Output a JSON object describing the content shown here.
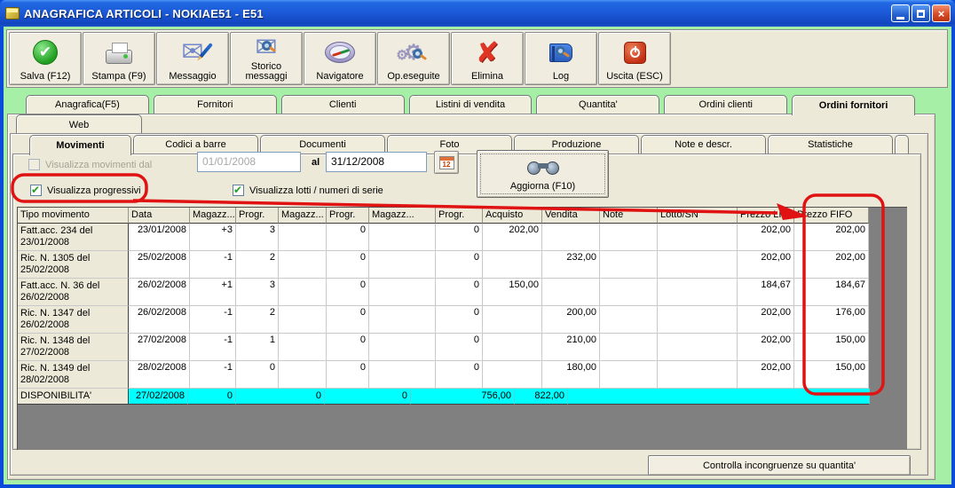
{
  "window": {
    "title": "ANAGRAFICA ARTICOLI - NOKIAE51 - E51",
    "controls": [
      "minimize",
      "maximize",
      "close"
    ]
  },
  "colors": {
    "titlebar_blue": "#1C5AD8",
    "window_green": "#A6EFA6",
    "panel_beige": "#ECE9D8",
    "grid_gray": "#808080",
    "availability_cyan": "#00FFFF",
    "annotation_red": "#E01212",
    "disabled_text": "#A5A395"
  },
  "toolbar": {
    "buttons": [
      {
        "label": "Salva (F12)",
        "icon": "save-check-icon"
      },
      {
        "label": "Stampa (F9)",
        "icon": "printer-icon"
      },
      {
        "label": "Messaggio",
        "icon": "message-envelope-icon"
      },
      {
        "label": "Storico messaggi",
        "icon": "message-history-icon"
      },
      {
        "label": "Navigatore",
        "icon": "navigator-compass-icon"
      },
      {
        "label": "Op.eseguite",
        "icon": "operations-gear-icon"
      },
      {
        "label": "Elimina",
        "icon": "delete-x-icon"
      },
      {
        "label": "Log",
        "icon": "log-book-icon"
      },
      {
        "label": "Uscita (ESC)",
        "icon": "exit-power-icon"
      }
    ]
  },
  "tabs_level1": {
    "items": [
      "Anagrafica(F5)",
      "Fornitori",
      "Clienti",
      "Listini di vendita",
      "Quantita'",
      "Ordini clienti",
      "Ordini fornitori"
    ],
    "active": "Ordini fornitori"
  },
  "tabs_level2": {
    "items": [
      "Web"
    ],
    "active": "Web"
  },
  "tabs_level3": {
    "items": [
      "Movimenti",
      "Codici a barre",
      "Documenti",
      "Foto",
      "Produzione",
      "Note e descr.",
      "Statistiche"
    ],
    "active": "Movimenti"
  },
  "filters": {
    "show_movements_label": "Visualizza movimenti dal",
    "date_from": "01/01/2008",
    "al_label": "al",
    "date_to": "31/12/2008",
    "calendar_icon_text": "12",
    "refresh_button_label": "Aggiorna (F10)",
    "show_progressives_label": "Visualizza progressivi",
    "show_lots_label": "Visualizza lotti /  numeri di serie"
  },
  "table": {
    "columns": [
      "Tipo movimento",
      "Data",
      "Magazz...",
      "Progr.",
      "Magazz...",
      "Progr.",
      "Magazz...",
      "Progr.",
      "Acquisto",
      "Vendita",
      "Note",
      "Lotto/SN",
      "Prezzo LIFO",
      "Prezzo FIFO"
    ],
    "rows": [
      [
        "Fatt.acc. 234 del 23/01/2008",
        "23/01/2008",
        "+3",
        "3",
        "",
        "0",
        "",
        "0",
        "202,00",
        "",
        "",
        "",
        "202,00",
        "202,00"
      ],
      [
        "Ric. N. 1305 del 25/02/2008",
        "25/02/2008",
        "-1",
        "2",
        "",
        "0",
        "",
        "0",
        "",
        "232,00",
        "",
        "",
        "202,00",
        "202,00"
      ],
      [
        "Fatt.acc. N. 36 del 26/02/2008",
        "26/02/2008",
        "+1",
        "3",
        "",
        "0",
        "",
        "0",
        "150,00",
        "",
        "",
        "",
        "184,67",
        "184,67"
      ],
      [
        "Ric. N. 1347 del 26/02/2008",
        "26/02/2008",
        "-1",
        "2",
        "",
        "0",
        "",
        "0",
        "",
        "200,00",
        "",
        "",
        "202,00",
        "176,00"
      ],
      [
        "Ric. N. 1348 del 27/02/2008",
        "27/02/2008",
        "-1",
        "1",
        "",
        "0",
        "",
        "0",
        "",
        "210,00",
        "",
        "",
        "202,00",
        "150,00"
      ],
      [
        "Ric. N. 1349 del 28/02/2008",
        "28/02/2008",
        "-1",
        "0",
        "",
        "0",
        "",
        "0",
        "",
        "180,00",
        "",
        "",
        "202,00",
        "150,00"
      ]
    ],
    "footer": {
      "label": "DISPONIBILITA'",
      "date": "27/02/2008",
      "values": [
        "0",
        "0",
        "0"
      ],
      "acquisto": "756,00",
      "vendita": "822,00"
    }
  },
  "bottom": {
    "check_button_label": "Controlla incongruenze su quantita'"
  },
  "annotations": {
    "highlight_1": "Visualizza progressivi checkbox circled in red",
    "highlight_2": "Prezzo FIFO column circled in red with arrow"
  }
}
